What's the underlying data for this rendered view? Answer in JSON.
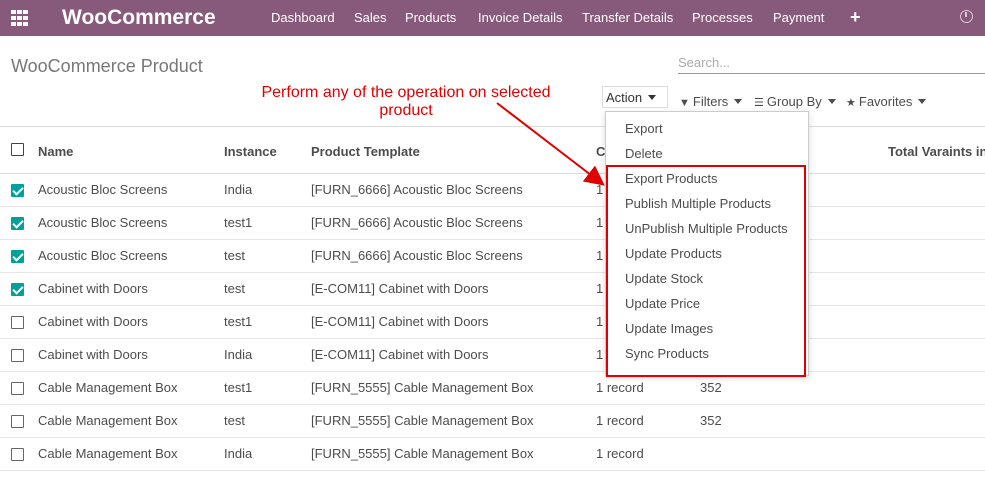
{
  "nav": {
    "brand": "WooCommerce",
    "items": [
      "Dashboard",
      "Sales",
      "Products",
      "Invoice Details",
      "Transfer Details",
      "Processes",
      "Payment"
    ],
    "plus": "+"
  },
  "control": {
    "title": "WooCommerce Product",
    "search_placeholder": "Search...",
    "action_label": "Action",
    "filters_label": "Filters",
    "group_by_label": "Group By",
    "favorites_label": "Favorites"
  },
  "annotation": {
    "line1": "Perform any of the operation on selected",
    "line2": "product"
  },
  "table": {
    "columns": [
      "Name",
      "Instance",
      "Product Template",
      "C",
      "Total Varaints in"
    ],
    "rows": [
      {
        "checked": true,
        "name": "Acoustic Bloc Screens",
        "instance": "India",
        "template": "[FURN_6666] Acoustic Bloc Screens",
        "count": "1",
        "value": ""
      },
      {
        "checked": true,
        "name": "Acoustic Bloc Screens",
        "instance": "test1",
        "template": "[FURN_6666] Acoustic Bloc Screens",
        "count": "1",
        "value": ""
      },
      {
        "checked": true,
        "name": "Acoustic Bloc Screens",
        "instance": "test",
        "template": "[FURN_6666] Acoustic Bloc Screens",
        "count": "1",
        "value": ""
      },
      {
        "checked": true,
        "name": "Cabinet with Doors",
        "instance": "test",
        "template": "[E-COM11] Cabinet with Doors",
        "count": "1",
        "value": ""
      },
      {
        "checked": false,
        "name": "Cabinet with Doors",
        "instance": "test1",
        "template": "[E-COM11] Cabinet with Doors",
        "count": "1",
        "value": ""
      },
      {
        "checked": false,
        "name": "Cabinet with Doors",
        "instance": "India",
        "template": "[E-COM11] Cabinet with Doors",
        "count": "1",
        "value": ""
      },
      {
        "checked": false,
        "name": "Cable Management Box",
        "instance": "test1",
        "template": "[FURN_5555] Cable Management Box",
        "count": "1 record",
        "value": "352"
      },
      {
        "checked": false,
        "name": "Cable Management Box",
        "instance": "test",
        "template": "[FURN_5555] Cable Management Box",
        "count": "1 record",
        "value": "352"
      },
      {
        "checked": false,
        "name": "Cable Management Box",
        "instance": "India",
        "template": "[FURN_5555] Cable Management Box",
        "count": "1 record",
        "value": ""
      }
    ]
  },
  "dropdown": {
    "items": [
      "Export",
      "Delete",
      "Export Products",
      "Publish Multiple Products",
      "UnPublish Multiple Products",
      "Update Products",
      "Update Stock",
      "Update Price",
      "Update Images",
      "Sync Products"
    ]
  },
  "colors": {
    "navbar": "#875a7b",
    "checkbox": "#00a09d",
    "annotation": "#e00000"
  }
}
